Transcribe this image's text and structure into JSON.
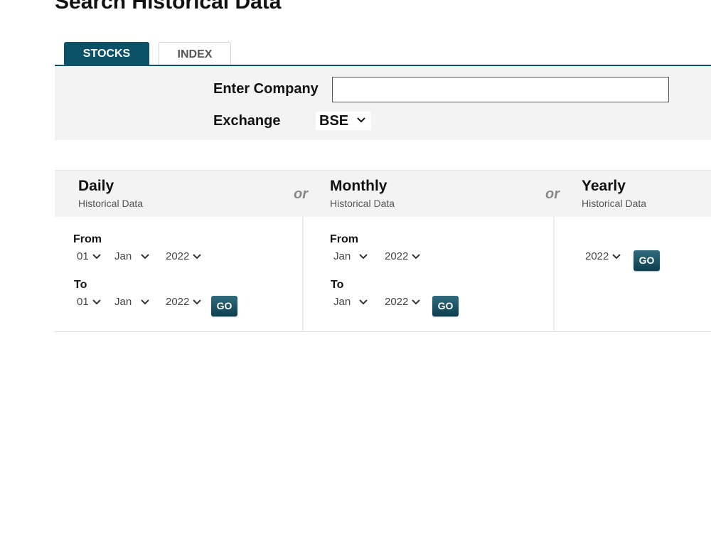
{
  "page_title": "Search Historical Data",
  "tabs": [
    {
      "label": "STOCKS",
      "active": true
    },
    {
      "label": "INDEX",
      "active": false
    }
  ],
  "search": {
    "company_label": "Enter Company",
    "company_value": "",
    "exchange_label": "Exchange",
    "exchange_value": "BSE"
  },
  "separator": "or",
  "daily": {
    "title": "Daily",
    "subtitle": "Historical Data",
    "from_label": "From",
    "to_label": "To",
    "from": {
      "day": "01",
      "month": "Jan",
      "year": "2022"
    },
    "to": {
      "day": "01",
      "month": "Jan",
      "year": "2022"
    },
    "go_label": "GO"
  },
  "monthly": {
    "title": "Monthly",
    "subtitle": "Historical Data",
    "from_label": "From",
    "to_label": "To",
    "from": {
      "month": "Jan",
      "year": "2022"
    },
    "to": {
      "month": "Jan",
      "year": "2022"
    },
    "go_label": "GO"
  },
  "yearly": {
    "title": "Yearly",
    "subtitle": "Historical Data",
    "year": "2022",
    "go_label": "GO"
  },
  "colors": {
    "accent": "#0b5268",
    "panel_bg": "#f3f3f3"
  }
}
